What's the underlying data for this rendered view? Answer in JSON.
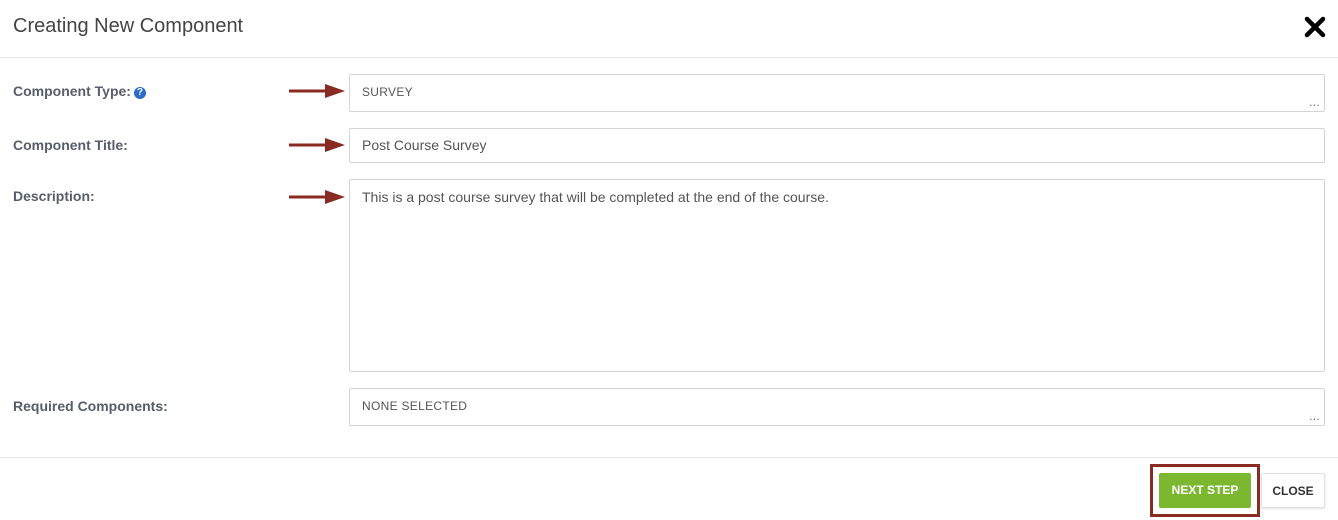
{
  "modal": {
    "title": "Creating New Component",
    "close_icon": "close-x-icon"
  },
  "form": {
    "component_type": {
      "label": "Component Type:",
      "help_icon": "question-circle-icon",
      "value": "SURVEY",
      "ellipsis": "..."
    },
    "component_title": {
      "label": "Component Title:",
      "value": "Post Course Survey"
    },
    "description": {
      "label": "Description:",
      "value": "This is a post course survey that will be completed at the end of the course."
    },
    "required_components": {
      "label": "Required Components:",
      "value": "NONE SELECTED",
      "ellipsis": "..."
    }
  },
  "footer": {
    "next_step_label": "NEXT STEP",
    "close_label": "CLOSE"
  },
  "annotations": {
    "arrow_icon": "right-arrow-icon",
    "arrow_color": "#8a2b22",
    "highlight_color": "#8a2b22"
  },
  "colors": {
    "primary_button": "#7cb82f",
    "help_icon": "#2b6cc4"
  }
}
